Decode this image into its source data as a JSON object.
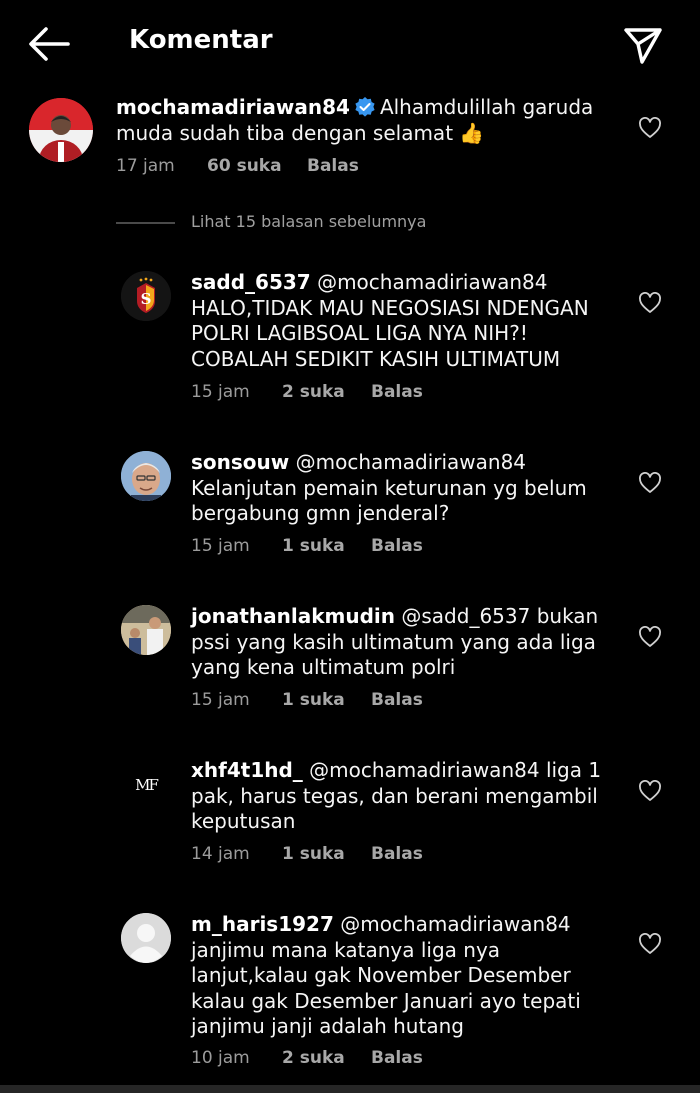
{
  "header": {
    "title": "Komentar",
    "back_icon": "arrow-left-icon",
    "send_icon": "paper-plane-icon"
  },
  "main_comment": {
    "username": "mochamadiriawan84",
    "verified": true,
    "text": "Alhamdulillah garuda muda sudah tiba dengan selamat 👍",
    "time": "17 jam",
    "likes": "60 suka",
    "reply": "Balas"
  },
  "view_previous": "Lihat 15 balasan sebelumnya",
  "replies": [
    {
      "username": "sadd_6537",
      "mention": "@mochamadiriawan84",
      "text": "HALO,TIDAK MAU NEGOSIASI NDENGAN POLRI LAGIBSOAL LIGA NYA NIH?! COBALAH SEDIKIT KASIH ULTIMATUM",
      "time": "15 jam",
      "likes": "2 suka",
      "reply": "Balas"
    },
    {
      "username": "sonsouw",
      "mention": "@mochamadiriawan84",
      "text": "Kelanjutan pemain keturunan yg belum bergabung gmn jenderal?",
      "time": "15 jam",
      "likes": "1 suka",
      "reply": "Balas"
    },
    {
      "username": "jonathanlakmudin",
      "mention": "@sadd_6537",
      "text": "bukan pssi yang kasih ultimatum yang ada liga yang kena ultimatum polri",
      "time": "15 jam",
      "likes": "1 suka",
      "reply": "Balas"
    },
    {
      "username": "xhf4t1hd_",
      "mention": "@mochamadiriawan84",
      "text": "liga 1 pak, harus tegas, dan berani mengambil keputusan",
      "time": "14 jam",
      "likes": "1 suka",
      "reply": "Balas"
    },
    {
      "username": "m_haris1927",
      "mention": "@mochamadiriawan84",
      "text": "janjimu mana katanya liga nya lanjut,kalau gak November Desember kalau gak Desember Januari ayo tepati janjimu janji adalah hutang",
      "time": "10 jam",
      "likes": "2 suka",
      "reply": "Balas"
    }
  ],
  "colors": {
    "background": "#000000",
    "text": "#f5f5f5",
    "secondary": "#9c9c9c",
    "verified_blue": "#3897f0"
  }
}
